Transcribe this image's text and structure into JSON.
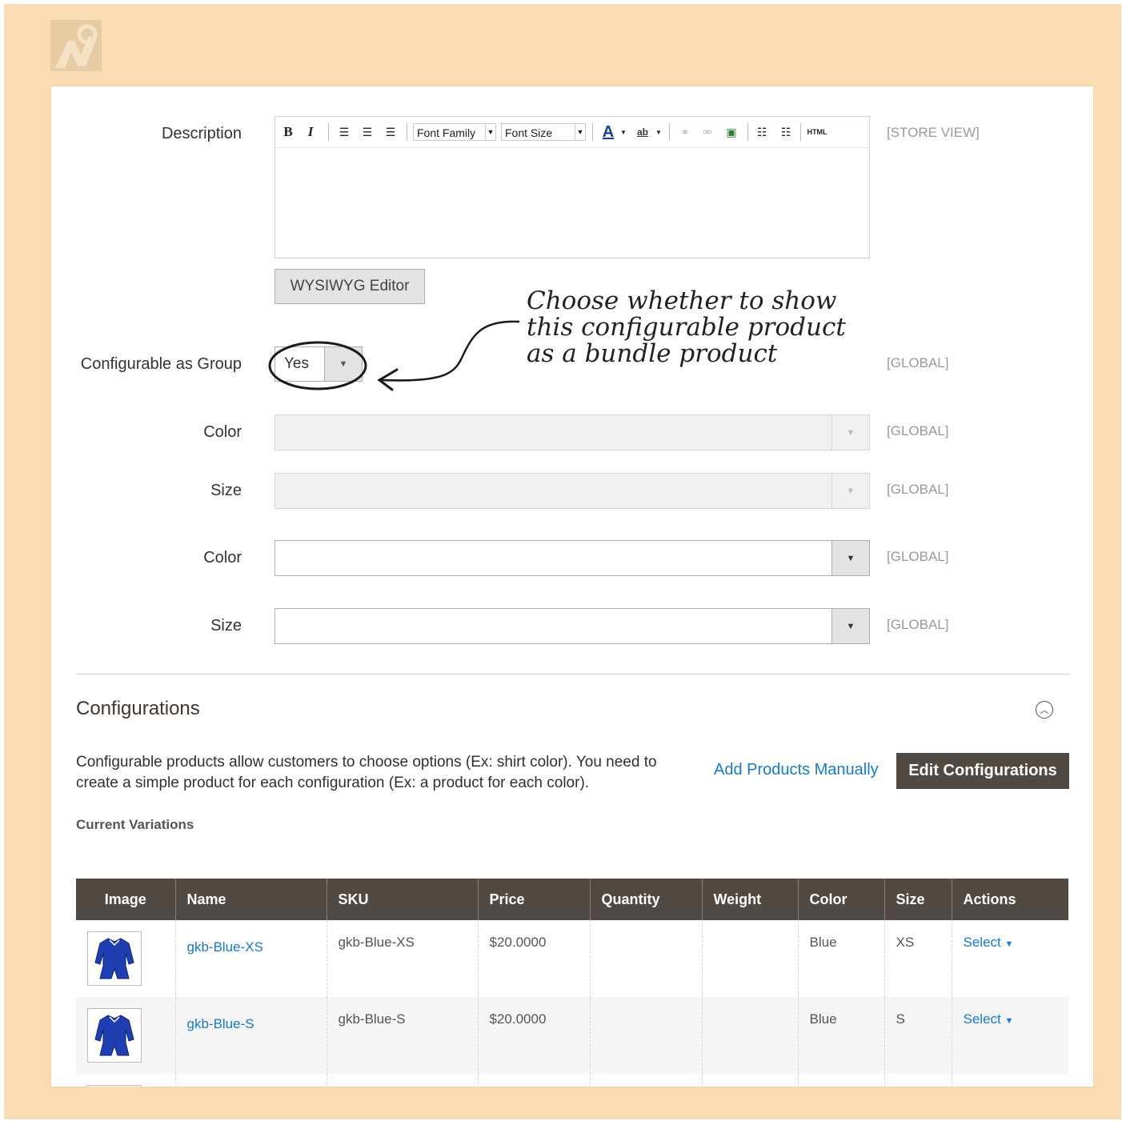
{
  "description": {
    "label": "Description",
    "scope": "[STORE VIEW]",
    "toolbar": {
      "bold": "B",
      "italic": "I",
      "font_family": "Font Family",
      "font_size": "Font Size",
      "text_color": "A",
      "highlight": "ab",
      "html": "HTML"
    },
    "wysiwyg_button": "WYSIWYG Editor"
  },
  "configurable_group": {
    "label": "Configurable as Group",
    "value": "Yes",
    "scope": "[GLOBAL]"
  },
  "annotation": {
    "line1": "Choose whether to show",
    "line2": "this configurable product",
    "line3": "as a bundle product"
  },
  "attributes": [
    {
      "label": "Color",
      "scope": "[GLOBAL]",
      "disabled": true
    },
    {
      "label": "Size",
      "scope": "[GLOBAL]",
      "disabled": true
    },
    {
      "label": "Color",
      "scope": "[GLOBAL]",
      "disabled": false
    },
    {
      "label": "Size",
      "scope": "[GLOBAL]",
      "disabled": false
    }
  ],
  "configurations": {
    "title": "Configurations",
    "description": "Configurable products allow customers to choose options (Ex: shirt color). You need to create a simple product for each configuration (Ex: a product for each color).",
    "add_manually": "Add Products Manually",
    "edit_button": "Edit Configurations",
    "current_variations": "Current Variations",
    "columns": [
      "Image",
      "Name",
      "SKU",
      "Price",
      "Quantity",
      "Weight",
      "Color",
      "Size",
      "Actions"
    ],
    "rows": [
      {
        "name": "gkb-Blue-XS",
        "sku": "gkb-Blue-XS",
        "price": "$20.0000",
        "quantity": "",
        "weight": "",
        "color": "Blue",
        "size": "XS",
        "action": "Select"
      },
      {
        "name": "gkb-Blue-S",
        "sku": "gkb-Blue-S",
        "price": "$20.0000",
        "quantity": "",
        "weight": "",
        "color": "Blue",
        "size": "S",
        "action": "Select"
      }
    ]
  },
  "colors": {
    "page_bg": "#f9dcb3",
    "header_bg": "#514943",
    "link": "#1979c3"
  }
}
